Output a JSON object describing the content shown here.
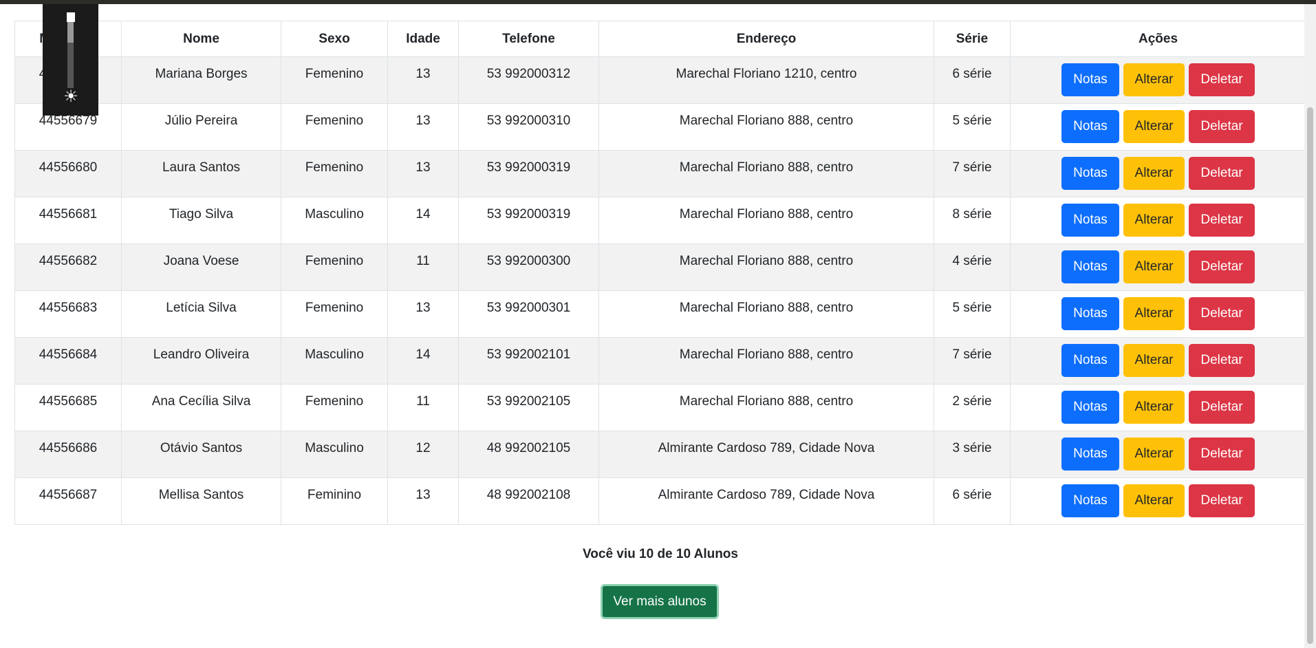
{
  "table": {
    "headers": [
      "Matrícula",
      "Nome",
      "Sexo",
      "Idade",
      "Telefone",
      "Endereço",
      "Série",
      "Ações"
    ],
    "rows": [
      {
        "matricula": "44556678",
        "nome": "Mariana Borges",
        "sexo": "Femenino",
        "idade": "13",
        "telefone": "53 992000312",
        "endereco": "Marechal Floriano 1210, centro",
        "serie": "6 série"
      },
      {
        "matricula": "44556679",
        "nome": "Júlio Pereira",
        "sexo": "Femenino",
        "idade": "13",
        "telefone": "53 992000310",
        "endereco": "Marechal Floriano 888, centro",
        "serie": "5 série"
      },
      {
        "matricula": "44556680",
        "nome": "Laura Santos",
        "sexo": "Femenino",
        "idade": "13",
        "telefone": "53 992000319",
        "endereco": "Marechal Floriano 888, centro",
        "serie": "7 série"
      },
      {
        "matricula": "44556681",
        "nome": "Tiago Silva",
        "sexo": "Masculino",
        "idade": "14",
        "telefone": "53 992000319",
        "endereco": "Marechal Floriano 888, centro",
        "serie": "8 série"
      },
      {
        "matricula": "44556682",
        "nome": "Joana Voese",
        "sexo": "Femenino",
        "idade": "11",
        "telefone": "53 992000300",
        "endereco": "Marechal Floriano 888, centro",
        "serie": "4 série"
      },
      {
        "matricula": "44556683",
        "nome": "Letícia Silva",
        "sexo": "Femenino",
        "idade": "13",
        "telefone": "53 992000301",
        "endereco": "Marechal Floriano 888, centro",
        "serie": "5 série"
      },
      {
        "matricula": "44556684",
        "nome": "Leandro Oliveira",
        "sexo": "Masculino",
        "idade": "14",
        "telefone": "53 992002101",
        "endereco": "Marechal Floriano 888, centro",
        "serie": "7 série"
      },
      {
        "matricula": "44556685",
        "nome": "Ana Cecília Silva",
        "sexo": "Femenino",
        "idade": "11",
        "telefone": "53 992002105",
        "endereco": "Marechal Floriano 888, centro",
        "serie": "2 série"
      },
      {
        "matricula": "44556686",
        "nome": "Otávio Santos",
        "sexo": "Masculino",
        "idade": "12",
        "telefone": "48 992002105",
        "endereco": "Almirante Cardoso 789, Cidade Nova",
        "serie": "3 série"
      },
      {
        "matricula": "44556687",
        "nome": "Mellisa Santos",
        "sexo": "Feminino",
        "idade": "13",
        "telefone": "48 992002108",
        "endereco": "Almirante Cardoso 789, Cidade Nova",
        "serie": "6 série"
      }
    ],
    "actions": {
      "notas": "Notas",
      "alterar": "Alterar",
      "deletar": "Deletar"
    }
  },
  "summary": "Você viu 10 de 10 Alunos",
  "more_button": "Ver mais alunos",
  "overlay": {
    "icon": "sun-icon",
    "brightness_level": 0.6
  },
  "colors": {
    "notas": "#0d6efd",
    "alterar": "#ffc107",
    "deletar": "#dc3545",
    "more": "#157347"
  }
}
